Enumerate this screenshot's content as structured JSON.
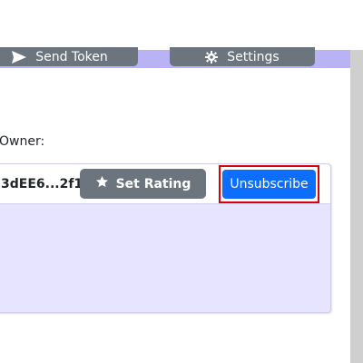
{
  "nav": {
    "send_token_label": "Send Token",
    "settings_label": "Settings",
    "send_icon": "send-icon",
    "settings_icon": "gear-icon",
    "strip_color": "#b9b3f5",
    "button_color": "#6c757d"
  },
  "owner": {
    "label": "Owner:"
  },
  "subscription": {
    "address": "3dEE6...2f1",
    "set_rating_label": "Set Rating",
    "set_rating_icon": "star-icon",
    "unsubscribe_label": "Unsubscribe",
    "card_color": "#e6e4ff",
    "unsubscribe_color": "#0d6efd",
    "highlight_color": "#d9000d"
  }
}
